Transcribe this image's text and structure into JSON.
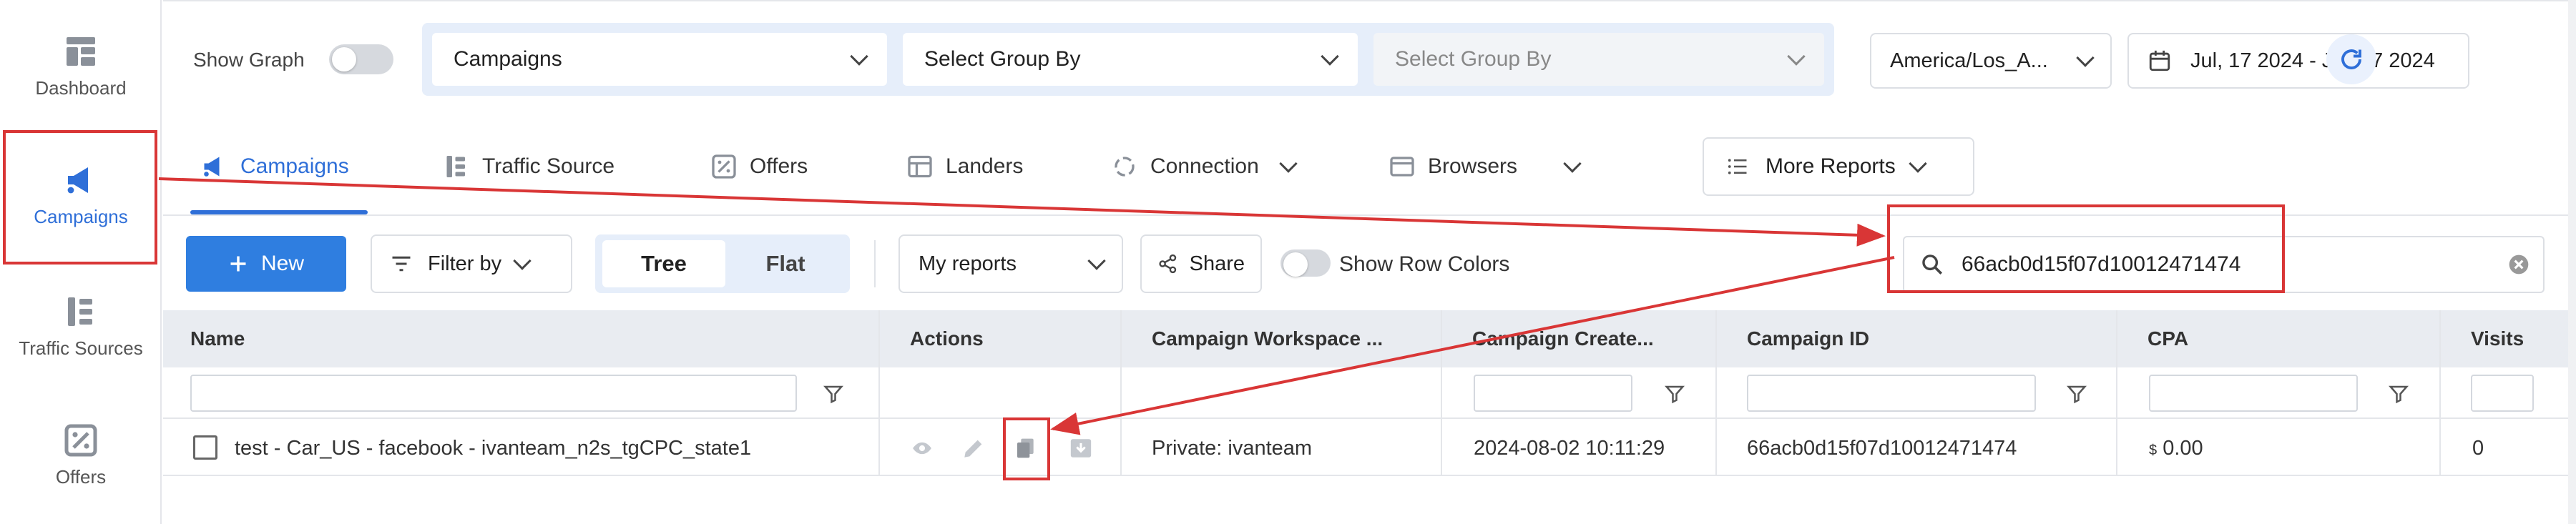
{
  "sidebar": {
    "items": [
      {
        "label": "Dashboard",
        "icon": "dashboard-icon"
      },
      {
        "label": "Campaigns",
        "icon": "megaphone-icon",
        "active": true
      },
      {
        "label": "Traffic Sources",
        "icon": "traffic-sources-icon"
      },
      {
        "label": "Offers",
        "icon": "percent-icon"
      }
    ]
  },
  "topbar": {
    "show_graph_label": "Show Graph",
    "group_by_1": "Campaigns",
    "group_by_2": "Select Group By",
    "group_by_3_placeholder": "Select Group By",
    "timezone": "America/Los_A...",
    "date_range": "Jul, 17 2024 - Jul, 17 2024"
  },
  "tabs": [
    {
      "label": "Campaigns",
      "icon": "megaphone-icon",
      "active": true
    },
    {
      "label": "Traffic Source",
      "icon": "traffic-source-icon"
    },
    {
      "label": "Offers",
      "icon": "percent-icon"
    },
    {
      "label": "Landers",
      "icon": "landers-icon"
    },
    {
      "label": "Connection",
      "icon": "connection-icon",
      "dropdown": true
    },
    {
      "label": "Browsers",
      "icon": "browser-icon",
      "dropdown": true
    }
  ],
  "more_reports_label": "More Reports",
  "toolbar": {
    "new_label": "New",
    "filter_label": "Filter by",
    "tree_label": "Tree",
    "flat_label": "Flat",
    "my_reports_label": "My reports",
    "share_label": "Share",
    "row_colors_label": "Show Row Colors",
    "search_value": "66acb0d15f07d10012471474"
  },
  "table": {
    "columns": [
      "Name",
      "Actions",
      "Campaign Workspace ...",
      "Campaign Create...",
      "Campaign ID",
      "CPA",
      "Visits"
    ],
    "rows": [
      {
        "name": "test - Car_US - facebook - ivanteam_n2s_tgCPC_state1",
        "workspace": "Private: ivanteam",
        "created": "2024-08-02 10:11:29",
        "campaign_id": "66acb0d15f07d10012471474",
        "cpa_symbol": "$",
        "cpa": "0.00",
        "visits": "0"
      }
    ]
  },
  "colors": {
    "accent": "#2f6fd8",
    "annotation": "#d93636"
  }
}
